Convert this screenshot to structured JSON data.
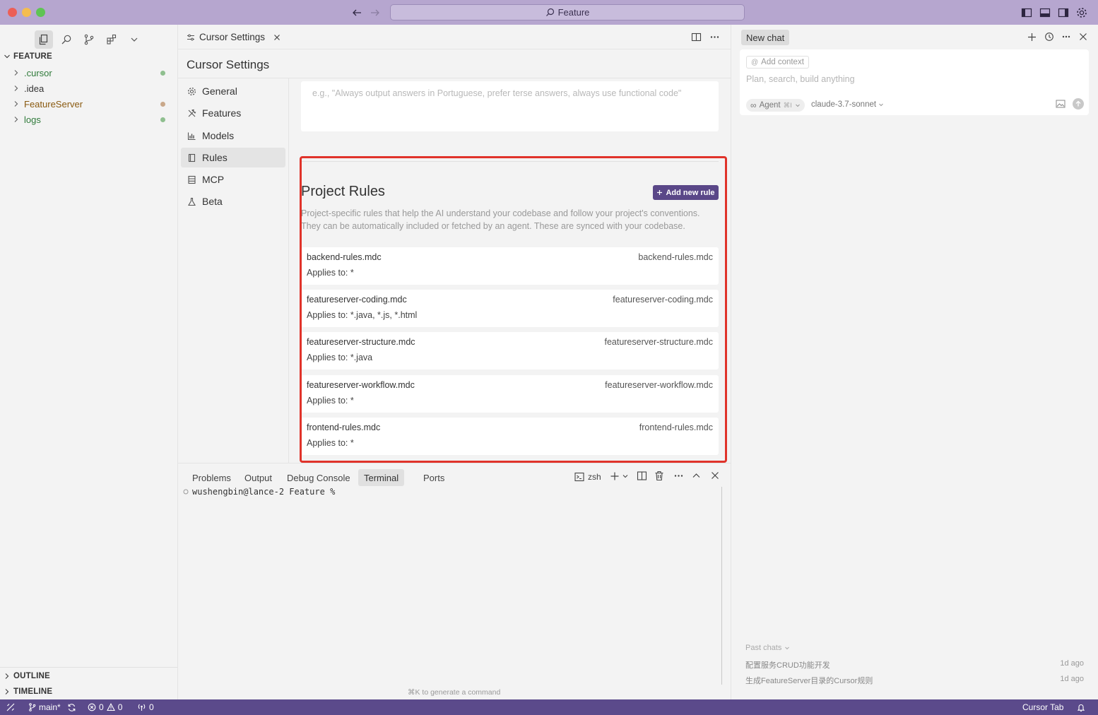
{
  "window": {
    "search_label": "Feature",
    "colors": {
      "title_bar": "#b6a6cf",
      "accent": "#5b4a8b",
      "highlight": "#e0332a"
    }
  },
  "explorer": {
    "root_label": "FEATURE",
    "items": [
      {
        "label": ".cursor",
        "color": "#2f7a3a",
        "dot": "#8fbf8f"
      },
      {
        "label": ".idea",
        "color": "#333333",
        "dot": ""
      },
      {
        "label": "FeatureServer",
        "color": "#8a5a10",
        "dot": "#c9a88a"
      },
      {
        "label": "logs",
        "color": "#2f7a3a",
        "dot": "#8fbf8f"
      }
    ],
    "outline_label": "OUTLINE",
    "timeline_label": "TIMELINE"
  },
  "editor": {
    "tab_label": "Cursor Settings",
    "settings_title": "Cursor Settings",
    "nav": [
      {
        "label": "General",
        "icon": "gear-icon"
      },
      {
        "label": "Features",
        "icon": "tools-icon"
      },
      {
        "label": "Models",
        "icon": "chart-icon"
      },
      {
        "label": "Rules",
        "icon": "book-icon"
      },
      {
        "label": "MCP",
        "icon": "server-icon"
      },
      {
        "label": "Beta",
        "icon": "flask-icon"
      }
    ],
    "user_rules_placeholder": "e.g., \"Always output answers in Portuguese, prefer terse answers, always use functional code\"",
    "project_rules": {
      "title": "Project Rules",
      "add_button": "Add new rule",
      "description_line1": "Project-specific rules that help the AI understand your codebase and follow your project's conventions.",
      "description_line2": "They can be automatically included or fetched by an agent. These are synced with your codebase.",
      "rules": [
        {
          "name": "backend-rules.mdc",
          "applies": "Applies to: *",
          "file": "backend-rules.mdc"
        },
        {
          "name": "featureserver-coding.mdc",
          "applies": "Applies to: *.java, *.js, *.html",
          "file": "featureserver-coding.mdc"
        },
        {
          "name": "featureserver-structure.mdc",
          "applies": "Applies to: *.java",
          "file": "featureserver-structure.mdc"
        },
        {
          "name": "featureserver-workflow.mdc",
          "applies": "Applies to: *",
          "file": "featureserver-workflow.mdc"
        },
        {
          "name": "frontend-rules.mdc",
          "applies": "Applies to: *",
          "file": "frontend-rules.mdc"
        }
      ]
    }
  },
  "panel": {
    "tabs": [
      "Problems",
      "Output",
      "Debug Console",
      "Terminal",
      "Ports"
    ],
    "active_tab": "Terminal",
    "shell_label": "zsh",
    "prompt": "wushengbin@lance-2 Feature %",
    "hint": "⌘K to generate a command"
  },
  "chat": {
    "new_chat_label": "New chat",
    "add_context": "Add context",
    "placeholder": "Plan, search, build anything",
    "agent_label": "Agent",
    "agent_shortcut": "⌘I",
    "model_label": "claude-3.7-sonnet",
    "past_chats_label": "Past chats",
    "past_chats": [
      {
        "title": "配置服务CRUD功能开发",
        "time": "1d ago"
      },
      {
        "title": "生成FeatureServer目录的Cursor规则",
        "time": "1d ago"
      }
    ]
  },
  "statusbar": {
    "branch": "main*",
    "errors": "0",
    "warnings": "0",
    "ports": "0",
    "right_label": "Cursor Tab"
  }
}
